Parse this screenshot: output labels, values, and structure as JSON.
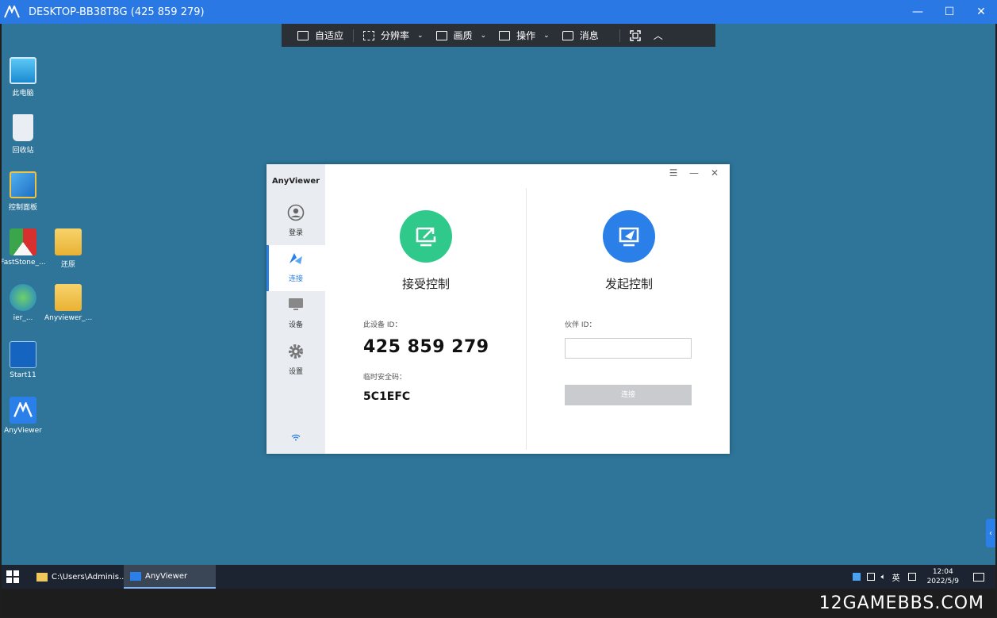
{
  "window": {
    "title": "DESKTOP-BB38T8G (425 859 279)",
    "controls": {
      "minimize": "—",
      "maximize": "☐",
      "close": "✕"
    }
  },
  "toolbar": {
    "items": [
      {
        "label": "自适应",
        "icon": "fit-icon"
      },
      {
        "label": "分辨率",
        "icon": "resolution-icon"
      },
      {
        "label": "画质",
        "icon": "quality-icon"
      },
      {
        "label": "操作",
        "icon": "keyboard-icon"
      },
      {
        "label": "消息",
        "icon": "message-icon"
      }
    ],
    "chevron": "⌄",
    "collapse": "︿"
  },
  "desktop": {
    "icons": [
      {
        "label": "此电脑"
      },
      {
        "label": "回收站"
      },
      {
        "label": "控制面板"
      },
      {
        "label": "FastStone_..."
      },
      {
        "label": "还原"
      },
      {
        "label": "ier_..."
      },
      {
        "label": "Anyviewer_..."
      },
      {
        "label": "Start11"
      },
      {
        "label": "AnyViewer"
      }
    ]
  },
  "app": {
    "name": "AnyViewer",
    "nav": [
      {
        "label": "登录",
        "icon": "user-icon"
      },
      {
        "label": "连接",
        "icon": "connect-icon"
      },
      {
        "label": "设备",
        "icon": "monitor-icon"
      },
      {
        "label": "设置",
        "icon": "gear-icon"
      }
    ],
    "controls": {
      "menu": "☰",
      "minimize": "—",
      "close": "✕"
    },
    "receive": {
      "title": "接受控制",
      "device_id_label": "此设备 ID：",
      "device_id": "425 859 279",
      "temp_code_label": "临时安全码：",
      "temp_code": "5C1EFC"
    },
    "initiate": {
      "title": "发起控制",
      "partner_label": "伙伴 ID：",
      "partner_value": "",
      "connect_button": "连接"
    }
  },
  "taskbar": {
    "tasks": [
      {
        "label": "C:\\Users\\Adminis..."
      },
      {
        "label": "AnyViewer"
      }
    ],
    "ime": "英",
    "time": "12:04",
    "date": "2022/5/9"
  },
  "watermark": "12GAMEBBS.COM",
  "colors": {
    "accent": "#2a7fe8",
    "green": "#2fc98b",
    "desktop": "#2e7599"
  }
}
